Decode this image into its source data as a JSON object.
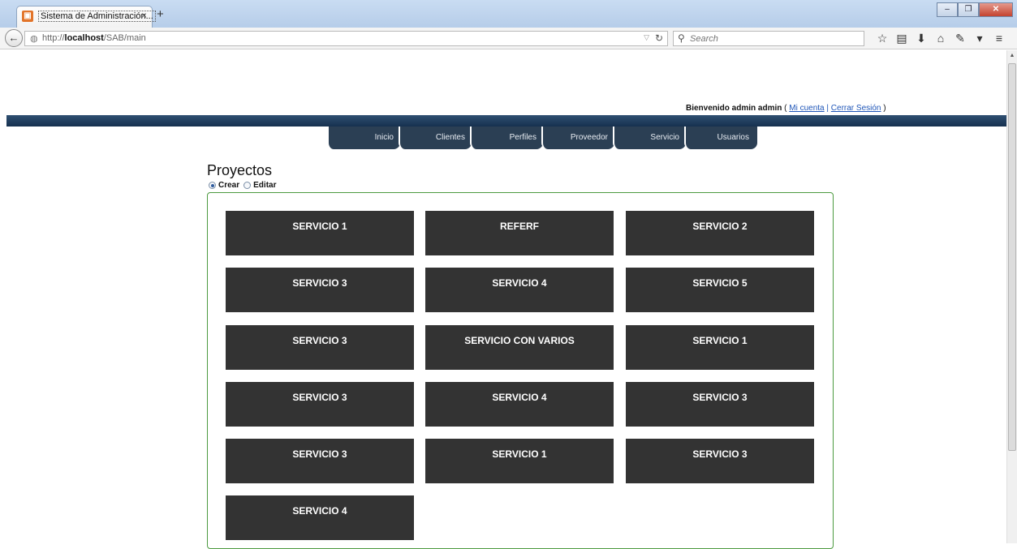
{
  "browser": {
    "tab_title": "Sistema de Administración...",
    "tab_close": "×",
    "new_tab": "+",
    "url_prefix": "http://",
    "url_host": "localhost",
    "url_path": "/SAB/main",
    "search_placeholder": "Search"
  },
  "header": {
    "welcome_text": "Bienvenido admin admin",
    "paren_open": "(",
    "my_account": "Mi cuenta",
    "separator": "|",
    "logout": "Cerrar Sesión",
    "paren_close": ")"
  },
  "menu": {
    "items": [
      {
        "label": "Inicio"
      },
      {
        "label": "Clientes"
      },
      {
        "label": "Perfiles"
      },
      {
        "label": "Proveedor"
      },
      {
        "label": "Servicio"
      },
      {
        "label": "Usuarios"
      }
    ]
  },
  "main": {
    "title": "Proyectos",
    "mode_options": [
      {
        "label": "Crear",
        "checked": true
      },
      {
        "label": "Editar",
        "checked": false
      }
    ],
    "services": [
      "SERVICIO 1",
      "REFERF",
      "SERVICIO 2",
      "SERVICIO 3",
      "SERVICIO 4",
      "SERVICIO 5",
      "SERVICIO 3",
      "SERVICIO CON VARIOS",
      "SERVICIO 1",
      "SERVICIO 3",
      "SERVICIO 4",
      "SERVICIO 3",
      "SERVICIO 3",
      "SERVICIO 1",
      "SERVICIO 3",
      "SERVICIO 4"
    ]
  },
  "colors": {
    "banner": "#1f3a5a",
    "menu_tab": "#2b3f54",
    "service_tile": "#333333",
    "panel_border": "#4c9a3f",
    "link": "#1f56b8"
  }
}
